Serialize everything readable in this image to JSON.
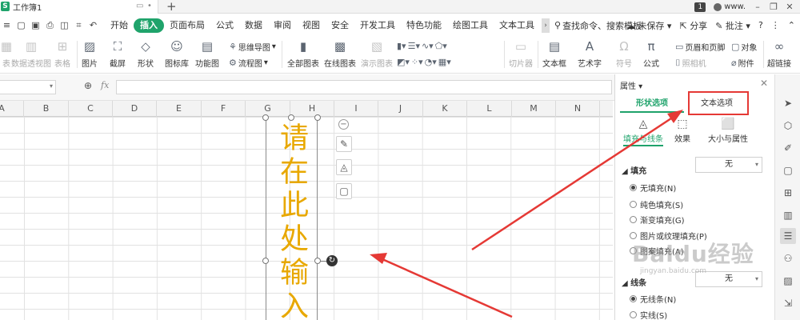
{
  "window": {
    "doc_tab_name": "工作簿1",
    "app_badge": "S",
    "page_badge": "1",
    "user_label": "www."
  },
  "menu": {
    "items": [
      "开始",
      "插入",
      "页面布局",
      "公式",
      "数据",
      "审阅",
      "视图",
      "安全",
      "开发工具",
      "特色功能",
      "绘图工具",
      "文本工具"
    ],
    "active": "插入",
    "search_label": "查找命令、搜索模板",
    "unsaved": "未保存",
    "share": "分享",
    "comment": "批注",
    "help": "?"
  },
  "ribbon": {
    "pivot_table": "表",
    "pivot_chart": "数据透视图",
    "table": "表格",
    "picture": "图片",
    "screenshot": "截屏",
    "shape": "形状",
    "icon_lib": "图标库",
    "func_chart": "功能图",
    "mindmap": "思维导图",
    "flowchart": "流程图",
    "all_charts": "全部图表",
    "online_chart": "在线图表",
    "demo_chart": "演示图表",
    "slicer": "切片器",
    "textbox": "文本框",
    "art_text": "艺术字",
    "symbol": "符号",
    "formula": "公式",
    "header_footer": "页眉和页脚",
    "object": "对象",
    "camera": "照相机",
    "attachment": "附件",
    "hyperlink": "超链接"
  },
  "formula_bar": {
    "fx": "fx"
  },
  "columns": [
    "A",
    "B",
    "C",
    "D",
    "E",
    "F",
    "G",
    "H",
    "I",
    "J",
    "K",
    "L",
    "M",
    "N"
  ],
  "textbox": {
    "text": "请在此处输入文字"
  },
  "panel": {
    "title": "属性",
    "tabs": [
      "形状选项",
      "文本选项"
    ],
    "active_tab": "形状选项",
    "subtabs": [
      "填充与线条",
      "效果",
      "大小与属性"
    ],
    "fill_section": "填充",
    "fill_value": "无",
    "fill_options": [
      "无填充(N)",
      "纯色填充(S)",
      "渐变填充(G)",
      "图片或纹理填充(P)",
      "图案填充(A)"
    ],
    "line_section": "线条",
    "line_value": "无",
    "line_options": [
      "无线条(N)",
      "实线(S)"
    ]
  },
  "watermark": {
    "text": "Baidu经验",
    "sub": "jingyan.baidu.com"
  },
  "colors": {
    "accent": "#1fa36b",
    "text_orange": "#e8a800",
    "highlight_red": "#e53935"
  }
}
